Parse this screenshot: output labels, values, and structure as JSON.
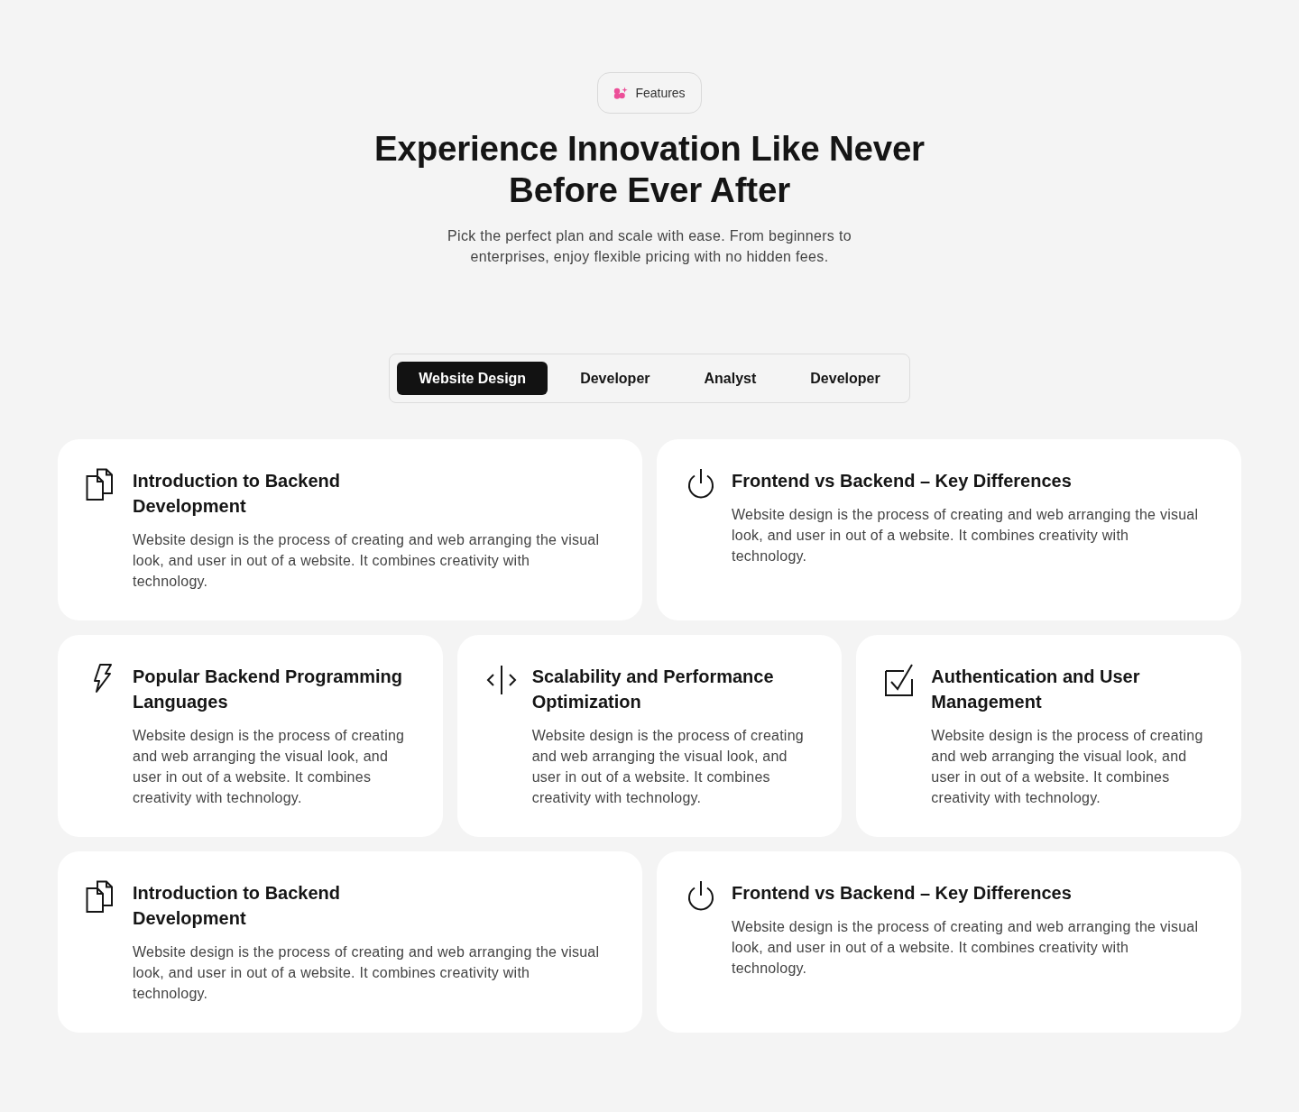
{
  "badge": {
    "label": "Features"
  },
  "heading": "Experience Innovation Like Never Before Ever After",
  "subtitle": "Pick the perfect plan and scale with ease. From beginners to enterprises, enjoy flexible pricing with no hidden fees.",
  "tabs": [
    {
      "label": "Website Design",
      "selected": true
    },
    {
      "label": "Developer",
      "selected": false
    },
    {
      "label": "Analyst",
      "selected": false
    },
    {
      "label": "Developer",
      "selected": false
    }
  ],
  "card_rows": [
    {
      "cards": [
        {
          "kind": "documents",
          "title": "Introduction to Backend\nDevelopment",
          "description": "Website design is the process of creating and web arranging the visual look, and user in out of a website. It combines creativity with technology."
        },
        {
          "kind": "power",
          "title": "Frontend vs Backend – Key Differences",
          "description": "Website design is the process of creating and web arranging the visual look, and user in out of a website. It combines creativity with technology."
        }
      ]
    },
    {
      "cards": [
        {
          "kind": "bolt",
          "title": "Popular Backend Programming Languages",
          "description": "Website design is the process of creating and web arranging the visual look, and user in out of a website. It combines creativity with technology."
        },
        {
          "kind": "code",
          "title": "Scalability and Performance Optimization",
          "description": "Website design is the process of creating and web arranging the visual look, and user in out of a website. It combines creativity with technology."
        },
        {
          "kind": "check",
          "title": "Authentication and User Management",
          "description": "Website design is the process of creating and web arranging the visual look, and user in out of a website. It combines creativity with technology."
        }
      ]
    },
    {
      "cards": [
        {
          "kind": "documents",
          "title": "Introduction to Backend\nDevelopment",
          "description": "Website design is the process of creating and web arranging the visual look, and user in out of a website. It combines creativity with technology."
        },
        {
          "kind": "power",
          "title": "Frontend vs Backend – Key Differences",
          "description": "Website design is the process of creating and web arranging the visual look, and user in out of a website. It combines creativity with technology."
        }
      ]
    }
  ]
}
